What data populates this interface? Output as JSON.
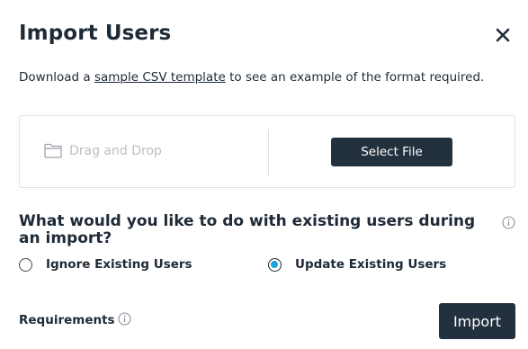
{
  "dialog": {
    "title": "Import Users",
    "close_icon": "close-icon"
  },
  "intro": {
    "prefix": "Download a ",
    "link_text": "sample CSV template",
    "suffix": " to see an example of the format required."
  },
  "upload": {
    "drop_label": "Drag and Drop",
    "drop_icon": "folder-icon",
    "select_file_label": "Select File"
  },
  "existing_users": {
    "question": "What would you like to do with existing users during an import?",
    "info_icon": "info-icon",
    "options": [
      {
        "label": "Ignore Existing Users",
        "selected": false
      },
      {
        "label": "Update Existing Users",
        "selected": true
      }
    ]
  },
  "footer": {
    "requirements_label": "Requirements",
    "requirements_icon": "info-icon",
    "import_label": "Import"
  },
  "colors": {
    "primary_button": "#23303d",
    "radio_selected": "#1aa3e0",
    "border": "#dfe3e8"
  }
}
